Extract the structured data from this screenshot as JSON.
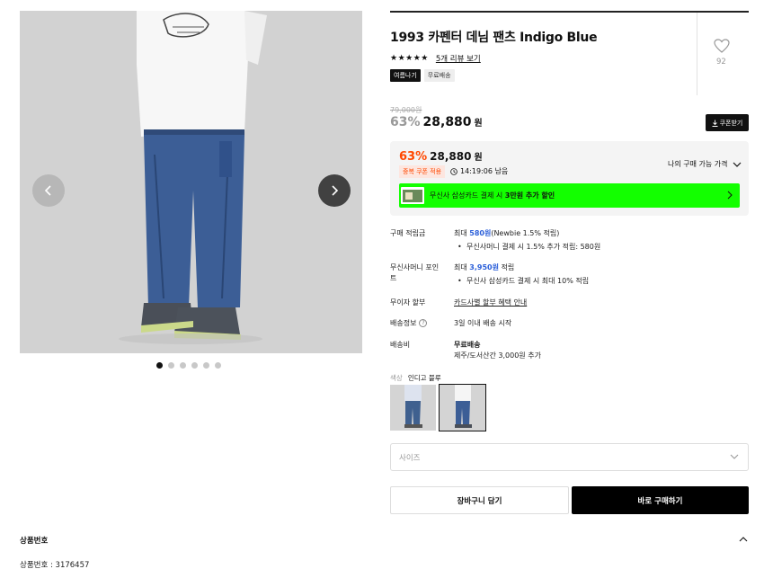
{
  "product": {
    "title": "1993 카펜터 데님 팬츠 Indigo Blue",
    "stars": "★★★★★",
    "review_link": "5개 리뷰 보기",
    "badges": [
      "여름나기",
      "무료배송"
    ],
    "like_count": "92"
  },
  "gallery": {
    "slide_count": 6,
    "active_index": 0
  },
  "price": {
    "original": "79,000원",
    "discount_pct": "63%",
    "current": "28,880",
    "currency": "원",
    "coupon_button": "쿠폰받기"
  },
  "price_box": {
    "discount_pct": "63%",
    "current": "28,880",
    "currency": "원",
    "dup_coupon": "중복 쿠폰 적용",
    "timer": "14:19:06 남음",
    "my_price_label": "나의 구매 가능 가격",
    "promo_text_prefix": "무신사 삼성카드 결제 시 ",
    "promo_text_bold": "3만원 추가 할인"
  },
  "info": {
    "points_label": "구매 적립금",
    "points_prefix": "최대 ",
    "points_amount": "580원",
    "points_suffix": "(Newbie 1.5% 적립)",
    "points_bullet": "무신사머니 결제 시 1.5% 추가 적립: 580원",
    "card_label": "무신사머니 포인트",
    "card_prefix": "최대 ",
    "card_amount": "3,950원",
    "card_suffix": " 적립",
    "card_bullet": "무신사 삼성카드 결제 시 최대 10% 적립",
    "installment_label": "무이자 할부",
    "installment_link": "카드사별 할부 혜택 안내",
    "shipping_label": "배송정보",
    "shipping_value": "3일 이내 배송 시작",
    "fee_label": "배송비",
    "fee_value": "무료배송",
    "fee_extra": "제주/도서산간 3,000원 추가"
  },
  "options": {
    "color_key": "색상",
    "color_value": "인디고 블루",
    "size_placeholder": "사이즈"
  },
  "actions": {
    "cart": "장바구니 담기",
    "buy": "바로 구매하기"
  },
  "section": {
    "heading": "상품번호",
    "body": "상품번호 : 3176457"
  },
  "colors": {
    "accent": "#ff4800",
    "promo_green": "#13ff00",
    "link_blue": "#2b5fd9"
  }
}
